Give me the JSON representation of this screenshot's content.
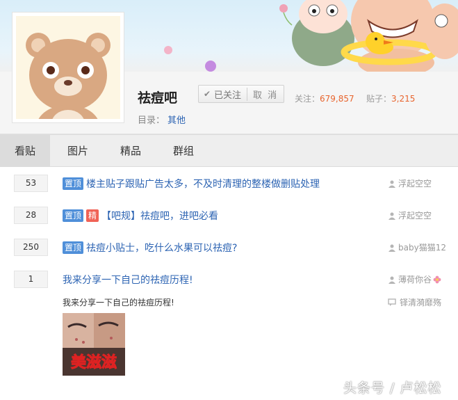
{
  "forum": {
    "name": "祛痘吧",
    "follow_state": "已关注",
    "unfollow_label": "取 消",
    "followers_label": "关注：",
    "followers_count": "679,857",
    "posts_label": "贴子：",
    "posts_count": "3,215",
    "directory_label": "目录：",
    "directory_value": "其他"
  },
  "tabs": [
    {
      "label": "看贴",
      "active": true
    },
    {
      "label": "图片",
      "active": false
    },
    {
      "label": "精品",
      "active": false
    },
    {
      "label": "群组",
      "active": false
    }
  ],
  "threads": [
    {
      "replies": "53",
      "badges": [
        "置顶"
      ],
      "title": "楼主贴子跟贴广告太多，不及时清理的整楼做删贴处理",
      "author": "浮起空空"
    },
    {
      "replies": "28",
      "badges": [
        "置顶",
        "精"
      ],
      "title": "【吧规】祛痘吧，进吧必看",
      "author": "浮起空空"
    },
    {
      "replies": "250",
      "badges": [
        "置顶"
      ],
      "title": "祛痘小贴士，吃什么水果可以祛痘?",
      "author": "baby猫猫12"
    },
    {
      "replies": "1",
      "badges": [],
      "title": "我来分享一下自己的祛痘历程!",
      "author": "薄荷你谷",
      "excerpt": "我来分享一下自己的祛痘历程!",
      "last_reply": "铎清漪靡殇",
      "thumbnail_text": "美滋滋"
    }
  ],
  "watermark": "头条号 / 卢松松",
  "colors": {
    "link": "#2d64b3",
    "count": "#e8642d",
    "badge_top": "#4f8fd9",
    "badge_best": "#f06256"
  }
}
